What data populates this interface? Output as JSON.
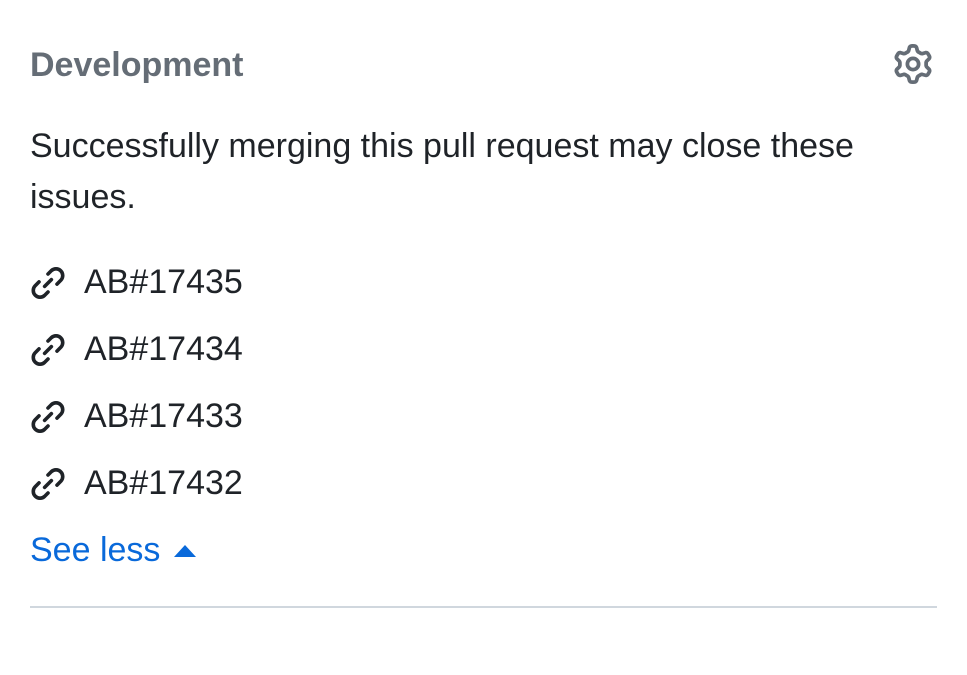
{
  "development": {
    "title": "Development",
    "description": "Successfully merging this pull request may close these issues.",
    "items": [
      {
        "label": "AB#17435"
      },
      {
        "label": "AB#17434"
      },
      {
        "label": "AB#17433"
      },
      {
        "label": "AB#17432"
      }
    ],
    "toggle_label": "See less"
  }
}
